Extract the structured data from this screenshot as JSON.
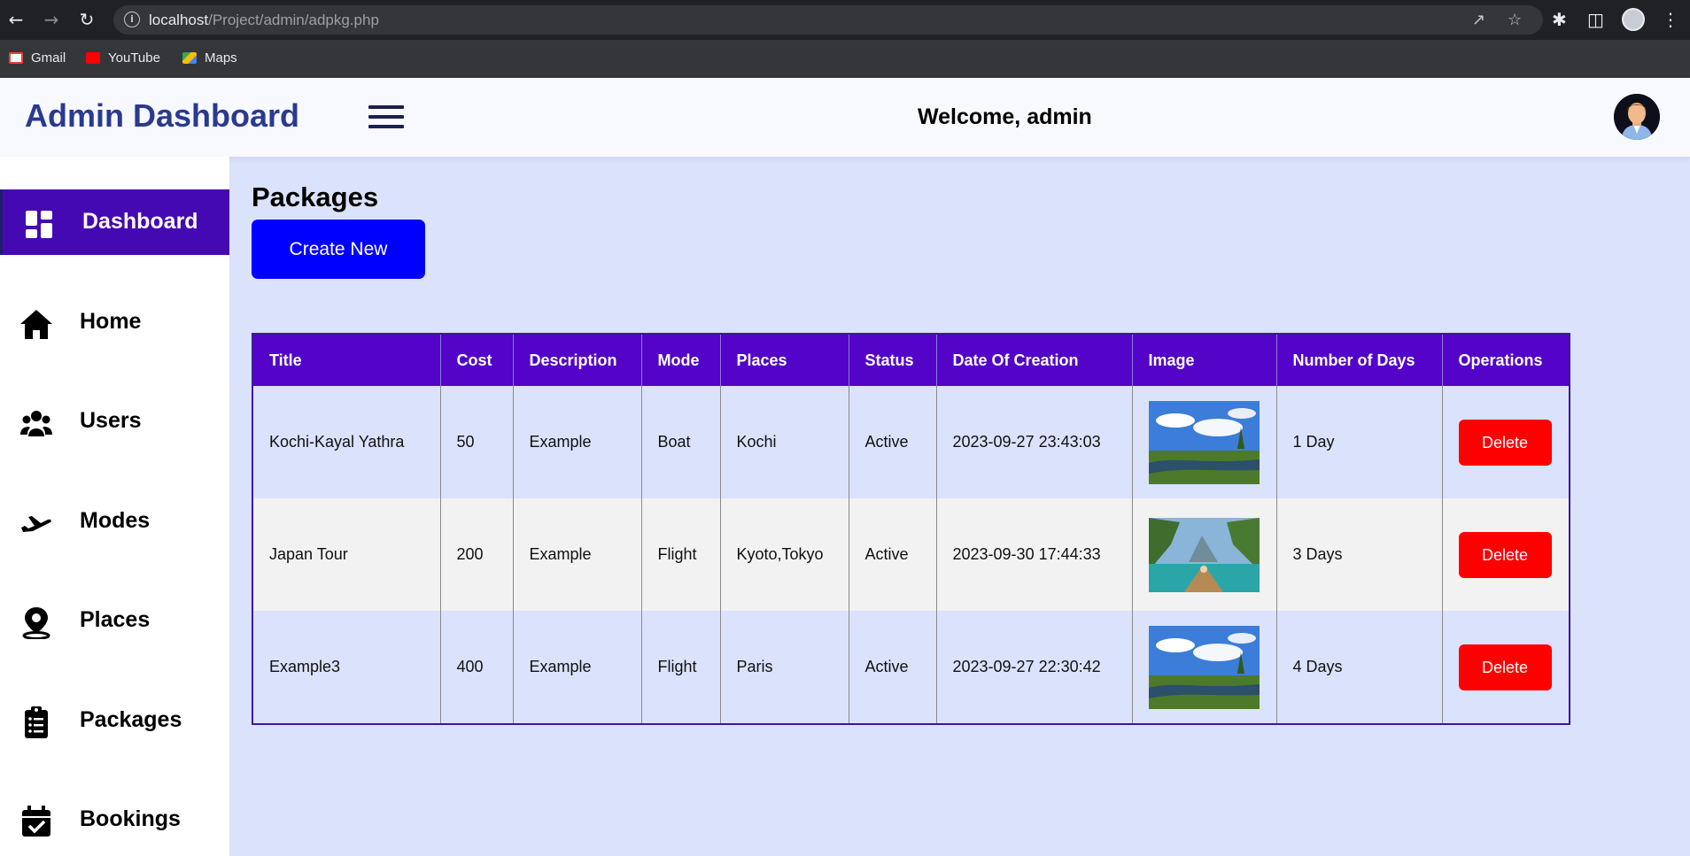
{
  "browser": {
    "url_host": "localhost",
    "url_path": "/Project/admin/adpkg.php",
    "bookmarks": [
      {
        "label": "Gmail",
        "icon": "gmail-icon"
      },
      {
        "label": "YouTube",
        "icon": "youtube-icon"
      },
      {
        "label": "Maps",
        "icon": "maps-icon"
      }
    ]
  },
  "header": {
    "brand": "Admin Dashboard",
    "welcome": "Welcome, admin"
  },
  "sidebar": {
    "items": [
      {
        "label": "Dashboard",
        "icon": "dashboard-icon",
        "active": true
      },
      {
        "label": "Home",
        "icon": "home-icon"
      },
      {
        "label": "Users",
        "icon": "users-icon"
      },
      {
        "label": "Modes",
        "icon": "plane-icon"
      },
      {
        "label": "Places",
        "icon": "map-pin-icon"
      },
      {
        "label": "Packages",
        "icon": "clipboard-icon"
      },
      {
        "label": "Bookings",
        "icon": "calendar-check-icon"
      }
    ]
  },
  "main": {
    "title": "Packages",
    "create_label": "Create New",
    "columns": [
      "Title",
      "Cost",
      "Description",
      "Mode",
      "Places",
      "Status",
      "Date Of Creation",
      "Image",
      "Number of Days",
      "Operations"
    ],
    "rows": [
      {
        "title": "Kochi-Kayal Yathra",
        "cost": "50",
        "description": "Example",
        "mode": "Boat",
        "places": "Kochi",
        "status": "Active",
        "date": "2023-09-27 23:43:03",
        "image": "river-landscape",
        "days": "1 Day",
        "action": "Delete"
      },
      {
        "title": "Japan Tour",
        "cost": "200",
        "description": "Example",
        "mode": "Flight",
        "places": "Kyoto,Tokyo",
        "status": "Active",
        "date": "2023-09-30 17:44:33",
        "image": "boat-lagoon",
        "days": "3 Days",
        "action": "Delete"
      },
      {
        "title": "Example3",
        "cost": "400",
        "description": "Example",
        "mode": "Flight",
        "places": "Paris",
        "status": "Active",
        "date": "2023-09-27 22:30:42",
        "image": "river-landscape",
        "days": "4 Days",
        "action": "Delete"
      }
    ]
  },
  "colors": {
    "sidebar_active": "#4409b2",
    "table_header": "#5304c8",
    "create_button": "#0000ff",
    "delete_button": "#ff0000",
    "content_bg": "#dbe2fb",
    "brand_text": "#2b3a8f"
  }
}
